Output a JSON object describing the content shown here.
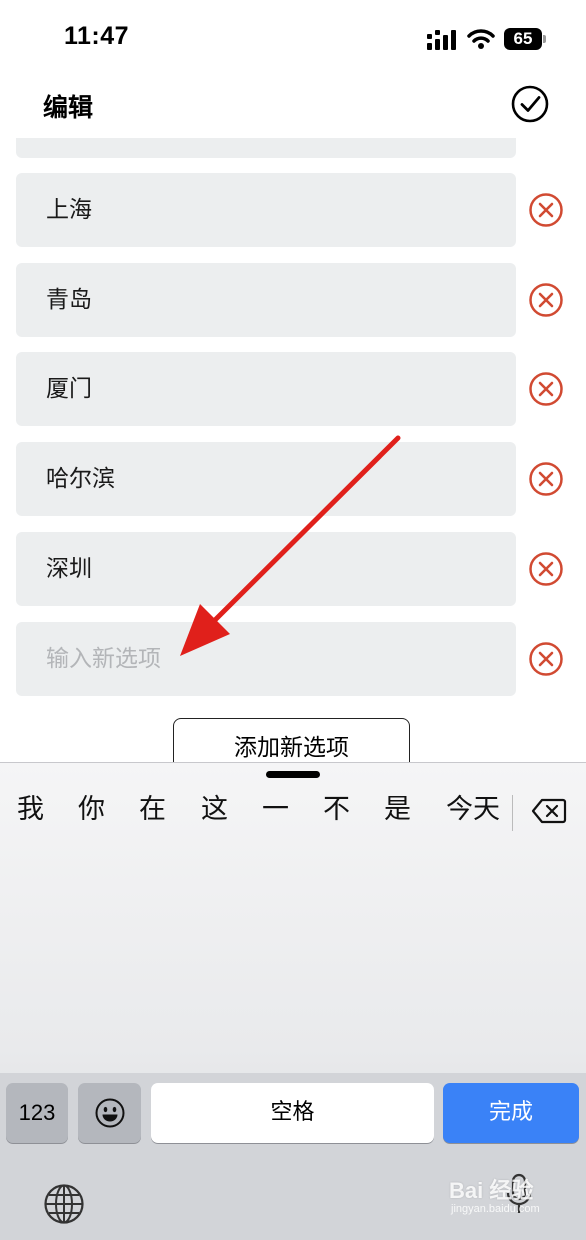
{
  "status_bar": {
    "time": "11:47",
    "battery": "65"
  },
  "header": {
    "title": "编辑"
  },
  "options": [
    {
      "label": "上海"
    },
    {
      "label": "青岛"
    },
    {
      "label": "厦门"
    },
    {
      "label": "哈尔滨"
    },
    {
      "label": "深圳"
    }
  ],
  "new_option": {
    "placeholder": "输入新选项",
    "value": ""
  },
  "add_button": {
    "label": "添加新选项"
  },
  "keyboard": {
    "candidates": [
      "我",
      "你",
      "在",
      "这",
      "一",
      "不",
      "是",
      "今天"
    ],
    "key_123": "123",
    "key_space": "空格",
    "key_done": "完成"
  },
  "watermark": {
    "brand": "Bai 经验",
    "url": "jingyan.baidu.com"
  },
  "colors": {
    "remove": "#d14a32",
    "annotation_arrow": "#e0201b",
    "done_key": "#3a82f7",
    "row_bg": "#eceeef"
  }
}
